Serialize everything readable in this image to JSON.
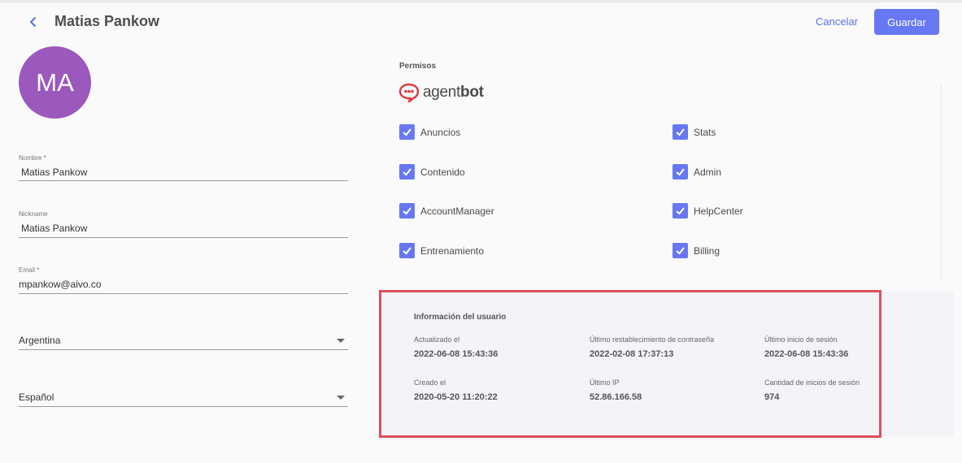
{
  "header": {
    "title": "Matias Pankow",
    "cancel_label": "Cancelar",
    "save_label": "Guardar"
  },
  "avatar": {
    "initials": "MA",
    "color": "#9b58bd"
  },
  "form": {
    "name": {
      "label": "Nombre *",
      "value": "Matias Pankow"
    },
    "nickname": {
      "label": "Nickname",
      "value": "Matias Pankow"
    },
    "email": {
      "label": "Email *",
      "value": "mpankow@aivo.co"
    },
    "country": {
      "value": "Argentina"
    },
    "language": {
      "value": "Español"
    }
  },
  "permissions": {
    "label": "Permisos",
    "brand": {
      "prefix": "agent",
      "suffix": "bot",
      "icon": "chat-bubble-icon",
      "color": "#e0393e"
    },
    "items": [
      {
        "label": "Anuncios",
        "checked": true
      },
      {
        "label": "Stats",
        "checked": true
      },
      {
        "label": "Contenido",
        "checked": true
      },
      {
        "label": "Admin",
        "checked": true
      },
      {
        "label": "AccountManager",
        "checked": true
      },
      {
        "label": "HelpCenter",
        "checked": true
      },
      {
        "label": "Entrenamiento",
        "checked": true
      },
      {
        "label": "Billing",
        "checked": true
      }
    ]
  },
  "user_info": {
    "title": "Información del usuario",
    "fields": [
      {
        "label": "Actualizado el",
        "value": "2022-06-08 15:43:36"
      },
      {
        "label": "Último restablecimiento de contraseña",
        "value": "2022-02-08 17:37:13"
      },
      {
        "label": "Último inicio de sesión",
        "value": "2022-06-08 15:43:36"
      },
      {
        "label": "Creado el",
        "value": "2020-05-20 11:20:22"
      },
      {
        "label": "Último IP",
        "value": "52.86.166.58"
      },
      {
        "label": "Cantidad de inicios de sesión",
        "value": "974"
      }
    ]
  },
  "colors": {
    "accent": "#6678f4",
    "highlight_border": "#e04e5a"
  }
}
